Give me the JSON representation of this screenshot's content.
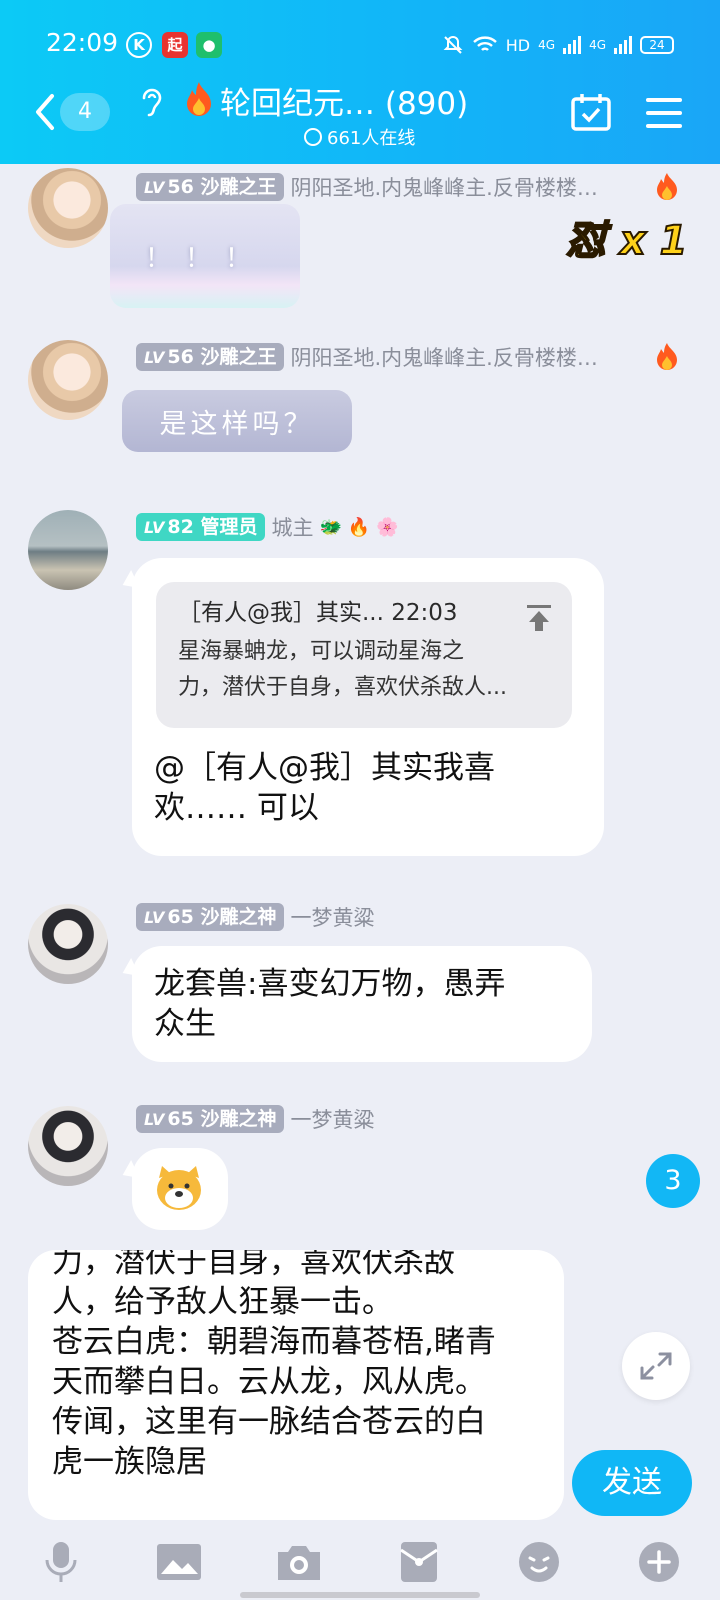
{
  "status_bar": {
    "time": "22:09",
    "app_k": "K",
    "app_red": "起",
    "network": "HD",
    "net1": "4G",
    "net2": "4G",
    "battery": "24"
  },
  "header": {
    "unread_count": "4",
    "title": "轮回纪元…  (890)",
    "online": "661人在线"
  },
  "messages": [
    {
      "level": "56",
      "rank": "沙雕之王",
      "title": "阴阳圣地.内鬼峰峰主.反骨楼楼…",
      "sticker_text": "！！！"
    },
    {
      "level": "56",
      "rank": "沙雕之王",
      "title": "阴阳圣地.内鬼峰峰主.反骨楼楼…",
      "sticker_text": "是这样吗？"
    },
    {
      "level": "82",
      "rank": "管理员",
      "title": "城主",
      "quote_head": "［有人@我］其实... 22:03",
      "quote_body_1": "星海暴蚺龙，可以调动星海之",
      "quote_body_2": "力，潜伏于自身，喜欢伏杀敌人...",
      "text_1": "@［有人@我］其实我喜",
      "text_2": "欢…… 可以"
    },
    {
      "level": "65",
      "rank": "沙雕之神",
      "title": "一梦黄粱",
      "text_1": "龙套兽:喜变幻万物，愚弄",
      "text_2": "众生"
    },
    {
      "level": "65",
      "rank": "沙雕之神",
      "title": "一梦黄粱"
    }
  ],
  "stamp_text": "怼 x 1",
  "new_message_count": "3",
  "input": {
    "text": "力，潜伏于自身，喜欢伏杀敌\n人，给予敌人狂暴一击。\n苍云白虎：朝碧海而暮苍梧,睹青\n天而攀白日。云从龙，风从虎。\n传闻，这里有一脉结合苍云的白\n虎一族隐居"
  },
  "send_label": "发送",
  "toolbar_icons": [
    "microphone-icon",
    "image-icon",
    "camera-icon",
    "red-packet-icon",
    "emoji-icon",
    "plus-icon"
  ]
}
